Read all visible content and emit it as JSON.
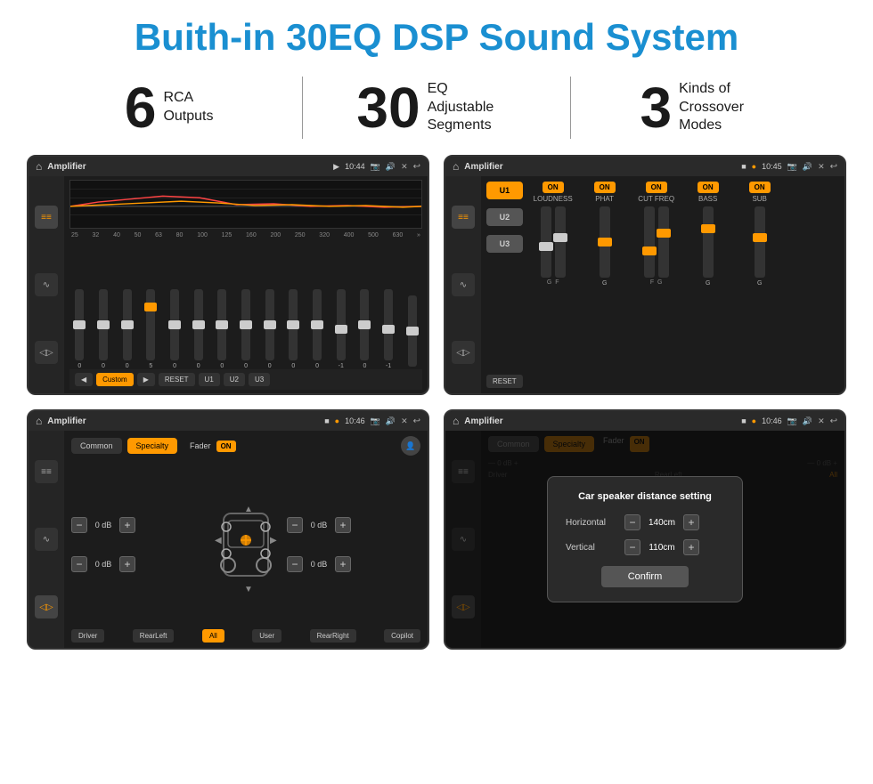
{
  "page": {
    "title": "Buith-in 30EQ DSP Sound System"
  },
  "stats": [
    {
      "number": "6",
      "label": "RCA\nOutputs"
    },
    {
      "number": "30",
      "label": "EQ Adjustable\nSegments"
    },
    {
      "number": "3",
      "label": "Kinds of\nCrossover Modes"
    }
  ],
  "screens": [
    {
      "id": "eq-screen",
      "title": "Amplifier",
      "time": "10:44",
      "type": "eq"
    },
    {
      "id": "xover-screen",
      "title": "Amplifier",
      "time": "10:45",
      "type": "crossover"
    },
    {
      "id": "fader-screen",
      "title": "Amplifier",
      "time": "10:46",
      "type": "fader"
    },
    {
      "id": "dist-screen",
      "title": "Amplifier",
      "time": "10:46",
      "type": "distance",
      "dialog": {
        "title": "Car speaker distance setting",
        "horizontal_label": "Horizontal",
        "horizontal_value": "140cm",
        "vertical_label": "Vertical",
        "vertical_value": "110cm",
        "confirm_label": "Confirm"
      }
    }
  ],
  "eq": {
    "freqs": [
      "25",
      "32",
      "40",
      "50",
      "63",
      "80",
      "100",
      "125",
      "160",
      "200",
      "250",
      "320",
      "400",
      "500",
      "630"
    ],
    "values": [
      "0",
      "0",
      "0",
      "5",
      "0",
      "0",
      "0",
      "0",
      "0",
      "0",
      "0",
      "-1",
      "0",
      "-1",
      ""
    ],
    "preset": "Custom",
    "buttons": [
      "RESET",
      "U1",
      "U2",
      "U3"
    ]
  },
  "xover": {
    "channels": [
      "U1",
      "U2",
      "U3"
    ],
    "controls": [
      {
        "label": "LOUDNESS",
        "on": true
      },
      {
        "label": "PHAT",
        "on": true
      },
      {
        "label": "CUT FREQ",
        "on": true
      },
      {
        "label": "BASS",
        "on": true
      },
      {
        "label": "SUB",
        "on": true
      }
    ]
  },
  "fader": {
    "tabs": [
      "Common",
      "Specialty"
    ],
    "fader_label": "Fader",
    "on": true,
    "db_values": [
      "0 dB",
      "0 dB",
      "0 dB",
      "0 dB"
    ],
    "buttons": [
      "Driver",
      "RearLeft",
      "All",
      "User",
      "RearRight",
      "Copilot"
    ]
  }
}
